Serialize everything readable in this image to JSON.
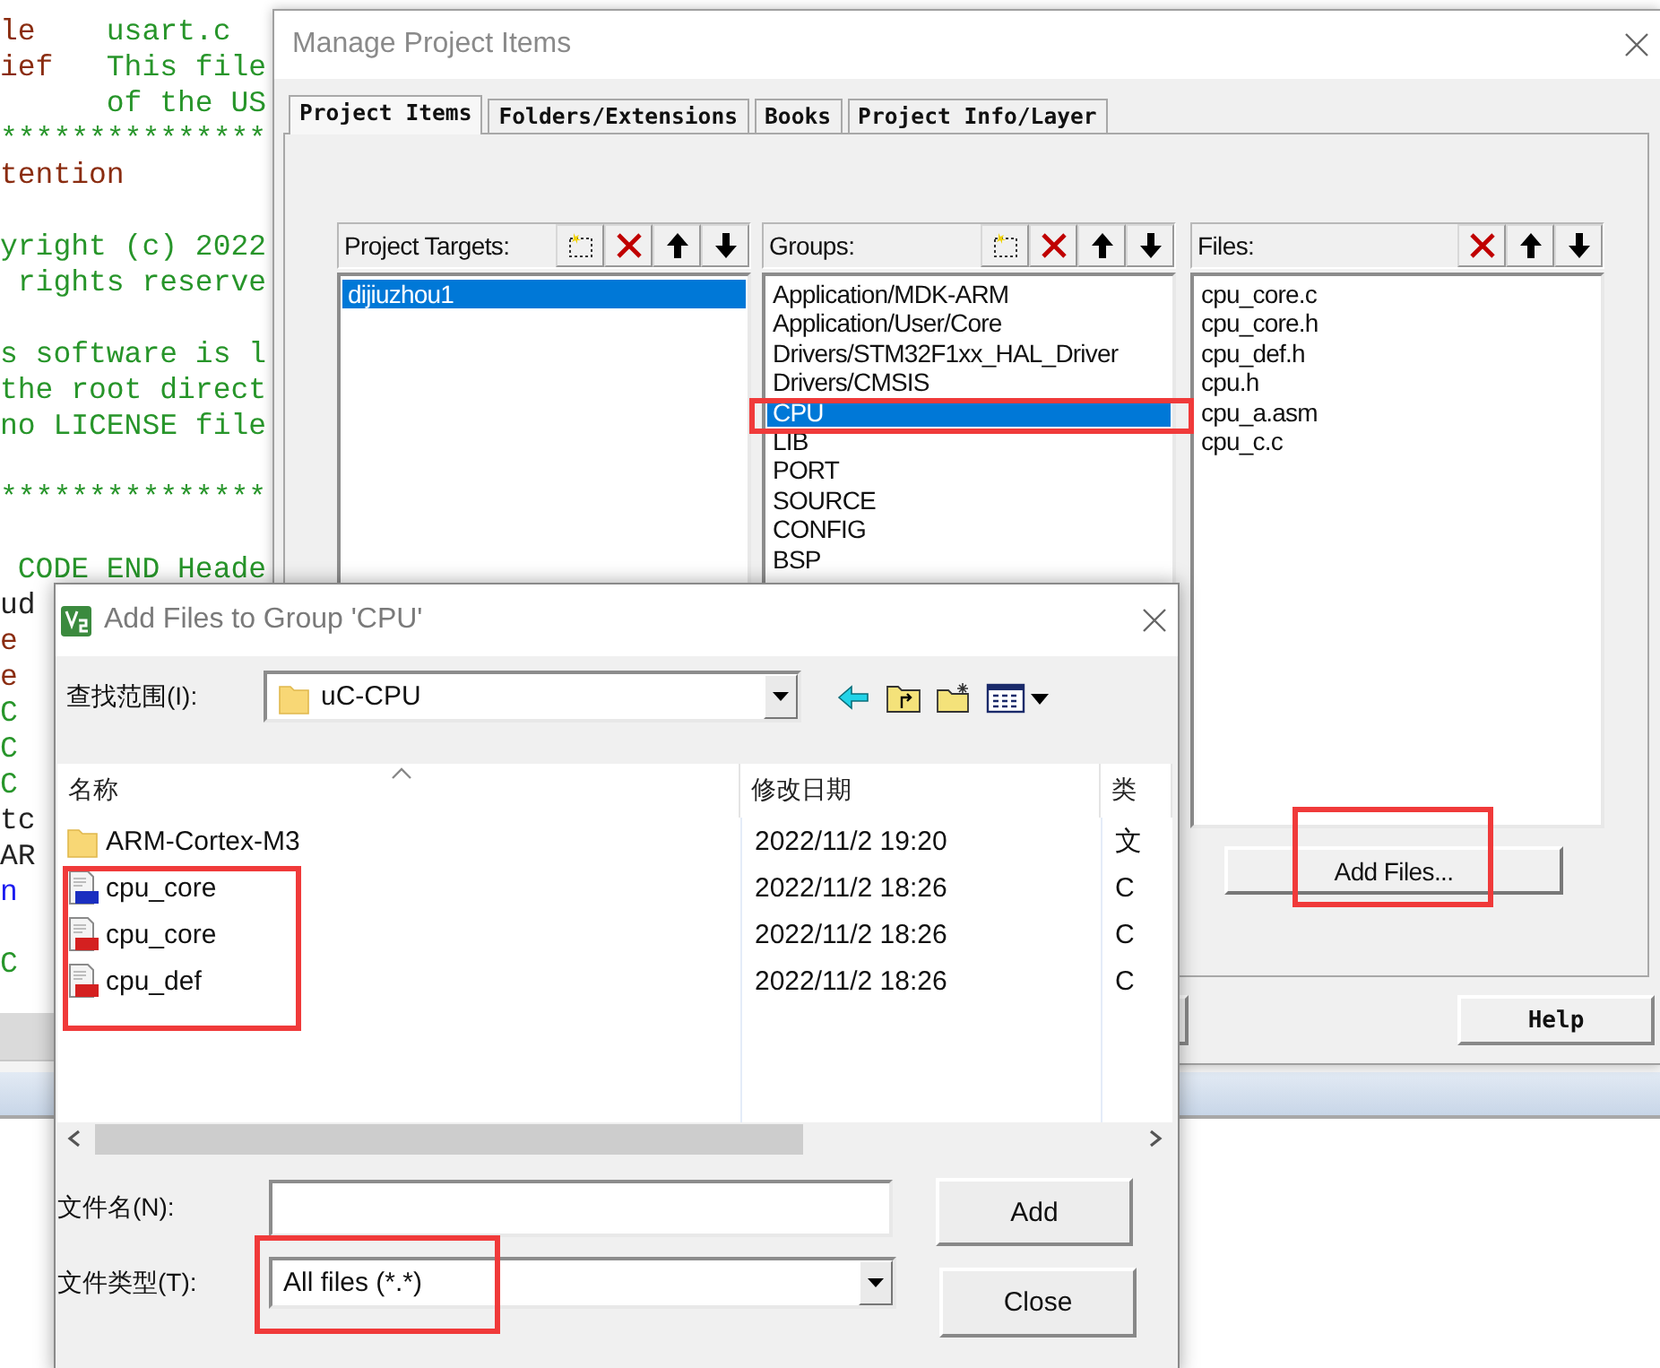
{
  "editor": {
    "lines": [
      {
        "kind": "code",
        "parts": [
          {
            "text": "le",
            "kind": "tag"
          },
          {
            "text": "usart.c",
            "kind": "comment"
          }
        ]
      },
      {
        "kind": "code",
        "parts": [
          {
            "text": "ief",
            "kind": "tag"
          },
          {
            "text": "This file",
            "kind": "comment"
          }
        ]
      },
      {
        "kind": "code",
        "parts": [
          {
            "text": "      of the US",
            "kind": "comment"
          }
        ]
      },
      {
        "kind": "code",
        "parts": [
          {
            "text": "***************",
            "kind": "comment"
          }
        ]
      },
      {
        "kind": "code",
        "parts": [
          {
            "text": "tention",
            "kind": "tag"
          }
        ]
      },
      {
        "kind": "blank"
      },
      {
        "kind": "code",
        "parts": [
          {
            "text": "yright (c) 2022",
            "kind": "comment"
          }
        ]
      },
      {
        "kind": "code",
        "parts": [
          {
            "text": " rights reserve",
            "kind": "comment"
          }
        ]
      },
      {
        "kind": "blank"
      },
      {
        "kind": "code",
        "parts": [
          {
            "text": "s software is l",
            "kind": "comment"
          }
        ]
      },
      {
        "kind": "code",
        "parts": [
          {
            "text": "the root direct",
            "kind": "comment"
          }
        ]
      },
      {
        "kind": "code",
        "parts": [
          {
            "text": "no LICENSE file",
            "kind": "comment"
          }
        ]
      },
      {
        "kind": "blank"
      },
      {
        "kind": "code",
        "parts": [
          {
            "text": "***************",
            "kind": "comment"
          }
        ]
      },
      {
        "kind": "blank"
      },
      {
        "kind": "code",
        "parts": [
          {
            "text": " CODE END Heade",
            "kind": "comment"
          }
        ]
      },
      {
        "kind": "code",
        "parts": [
          {
            "text": "ud",
            "kind": "plain"
          }
        ]
      },
      {
        "kind": "code",
        "parts": [
          {
            "text": "e",
            "kind": "tag"
          }
        ]
      },
      {
        "kind": "code",
        "parts": [
          {
            "text": "e",
            "kind": "tag"
          }
        ]
      },
      {
        "kind": "code",
        "parts": [
          {
            "text": "C",
            "kind": "comment"
          }
        ]
      },
      {
        "kind": "code",
        "parts": [
          {
            "text": "C",
            "kind": "comment"
          }
        ]
      },
      {
        "kind": "code",
        "parts": [
          {
            "text": "C",
            "kind": "comment"
          }
        ]
      },
      {
        "kind": "code",
        "parts": [
          {
            "text": "tc",
            "kind": "plain"
          }
        ]
      },
      {
        "kind": "code",
        "parts": [
          {
            "text": "AR",
            "kind": "plain"
          }
        ]
      },
      {
        "kind": "code",
        "parts": [
          {
            "text": "n",
            "kind": "keyword"
          }
        ]
      },
      {
        "kind": "blank"
      },
      {
        "kind": "code",
        "parts": [
          {
            "text": "C",
            "kind": "comment"
          }
        ]
      }
    ]
  },
  "manage_window": {
    "title": "Manage Project Items",
    "tabs": [
      {
        "label": "Project Items",
        "selected": true
      },
      {
        "label": "Folders/Extensions",
        "selected": false
      },
      {
        "label": "Books",
        "selected": false
      },
      {
        "label": "Project Info/Layer",
        "selected": false
      }
    ],
    "lists": [
      {
        "kind": "targets",
        "label": "Project Targets:",
        "items": [
          {
            "text": "dijiuzhou1",
            "selected": true
          }
        ]
      },
      {
        "kind": "groups",
        "label": "Groups:",
        "items": [
          {
            "text": "Application/MDK-ARM",
            "selected": false
          },
          {
            "text": "Application/User/Core",
            "selected": false
          },
          {
            "text": "Drivers/STM32F1xx_HAL_Driver",
            "selected": false
          },
          {
            "text": "Drivers/CMSIS",
            "selected": false
          },
          {
            "text": "CPU",
            "selected": true
          },
          {
            "text": "LIB",
            "selected": false
          },
          {
            "text": "PORT",
            "selected": false
          },
          {
            "text": "SOURCE",
            "selected": false
          },
          {
            "text": "CONFIG",
            "selected": false
          },
          {
            "text": "BSP",
            "selected": false
          }
        ]
      },
      {
        "kind": "files",
        "label": "Files:",
        "items": [
          {
            "text": "cpu_core.c",
            "selected": false
          },
          {
            "text": "cpu_core.h",
            "selected": false
          },
          {
            "text": "cpu_def.h",
            "selected": false
          },
          {
            "text": "cpu.h",
            "selected": false
          },
          {
            "text": "cpu_a.asm",
            "selected": false
          },
          {
            "text": "cpu_c.c",
            "selected": false
          }
        ]
      }
    ],
    "add_files_button": "Add Files...",
    "help_button": "Help"
  },
  "add_dialog": {
    "title": "Add Files to Group 'CPU'",
    "look_in_label": "查找范围(I):",
    "look_in_value": "uC-CPU",
    "columns": [
      "名称",
      "修改日期",
      "类"
    ],
    "rows": [
      {
        "kind": "folder",
        "name": "ARM-Cortex-M3",
        "date": "2022/11/2 19:20",
        "type": "文",
        "selected": false
      },
      {
        "kind": "c-file",
        "name": "cpu_core",
        "date": "2022/11/2 18:26",
        "type": "C",
        "selected": false
      },
      {
        "kind": "h-file",
        "name": "cpu_core",
        "date": "2022/11/2 18:26",
        "type": "C",
        "selected": false
      },
      {
        "kind": "h-file",
        "name": "cpu_def",
        "date": "2022/11/2 18:26",
        "type": "C",
        "selected": false
      }
    ],
    "file_name_label": "文件名(N):",
    "file_type_label": "文件类型(T):",
    "file_type_value": "All files (*.*)",
    "buttons": [
      "Add",
      "Close"
    ]
  }
}
